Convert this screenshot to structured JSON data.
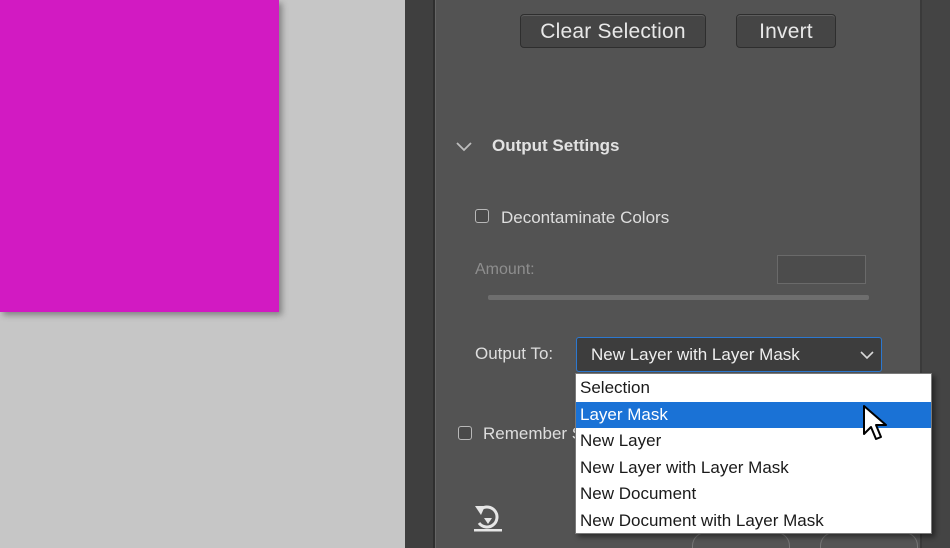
{
  "panel": {
    "clear_selection_label": "Clear Selection",
    "invert_label": "Invert",
    "output_settings_title": "Output Settings",
    "decontaminate_label": "Decontaminate Colors",
    "decontaminate_checked": false,
    "amount_label": "Amount:",
    "output_to_label": "Output To:",
    "output_to_value": "New Layer with Layer Mask",
    "remember_label": "Remember S",
    "remember_checked": false
  },
  "dropdown": {
    "options": [
      "Selection",
      "Layer Mask",
      "New Layer",
      "New Layer with Layer Mask",
      "New Document",
      "New Document with Layer Mask"
    ],
    "highlighted_index": 1
  },
  "colors": {
    "canvas_fill": "#d21ac2",
    "canvas_bg": "#c6c6c6",
    "panel_bg": "#535353",
    "accent": "#1a72d6"
  },
  "icons": {
    "section_toggle": "chevron-down-icon",
    "select_arrow": "chevron-down-icon",
    "reset": "reset-icon",
    "cursor": "arrow-cursor-icon"
  }
}
